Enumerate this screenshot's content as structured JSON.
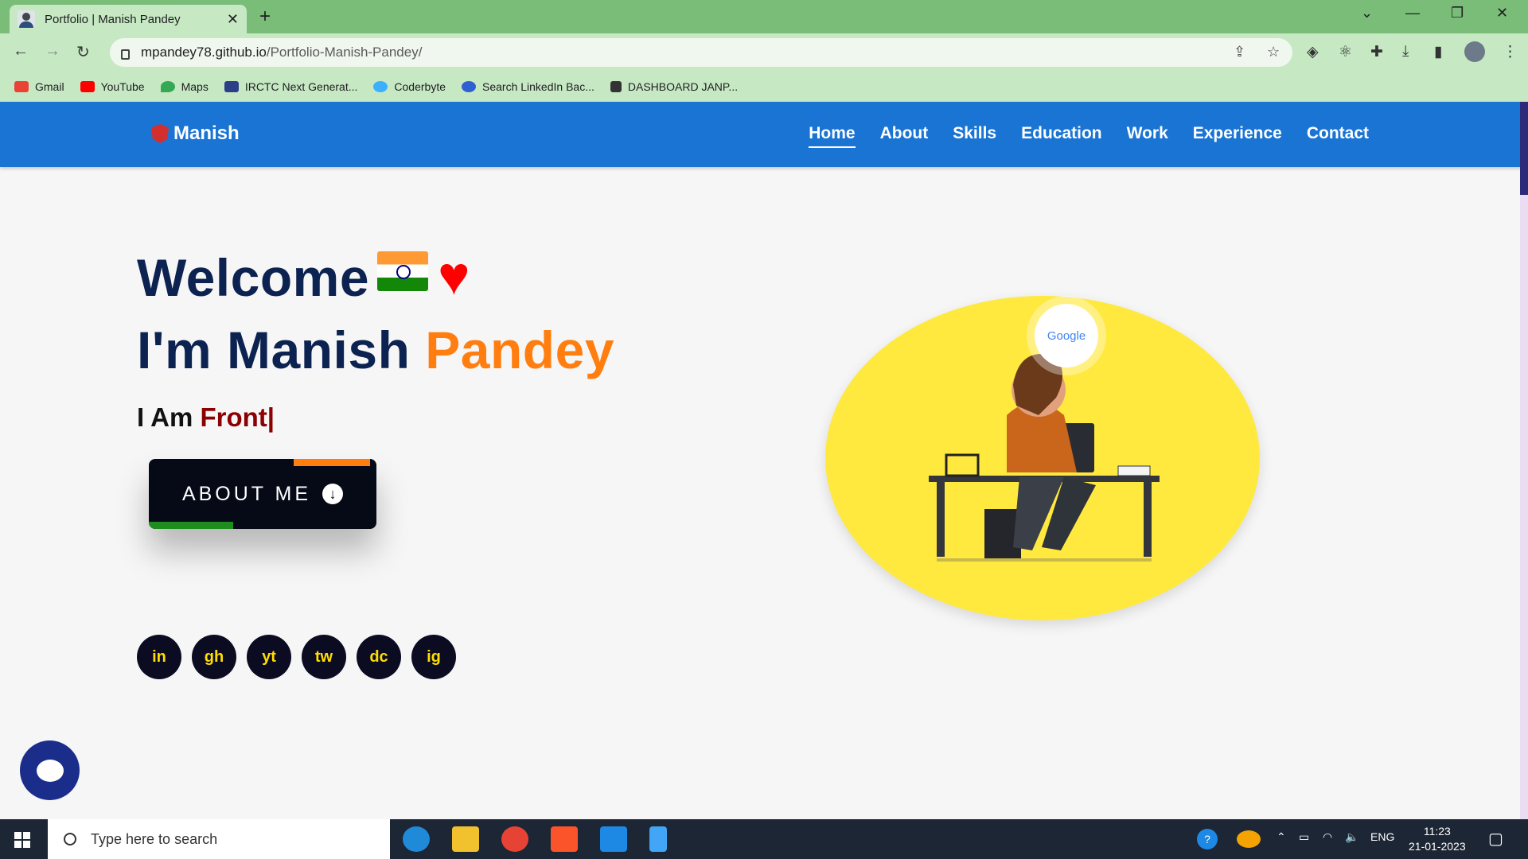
{
  "browser": {
    "tab_title": "Portfolio | Manish Pandey",
    "new_tab": "+",
    "url_host": "mpandey78.github.io",
    "url_path": "/Portfolio-Manish-Pandey/",
    "bookmarks": [
      "Gmail",
      "YouTube",
      "Maps",
      "IRCTC Next Generat...",
      "Coderbyte",
      "Search LinkedIn Bac...",
      "DASHBOARD JANP..."
    ]
  },
  "site": {
    "brand": "Manish",
    "menu": [
      "Home",
      "About",
      "Skills",
      "Education",
      "Work",
      "Experience",
      "Contact"
    ],
    "welcome": "Welcome",
    "heart": "♥",
    "name_prefix": "I'm Manish",
    "name_accent": "Pandey",
    "typed_prefix": "I Am",
    "typed_value": "Front|",
    "about_button": "ABOUT ME",
    "about_arrow": "↓",
    "socials": [
      "in",
      "gh",
      "yt",
      "tw",
      "dc",
      "ig"
    ],
    "google_label": "Google"
  },
  "taskbar": {
    "search_placeholder": "Type here to search",
    "language": "ENG",
    "time": "11:23",
    "date": "21-01-2023"
  },
  "colors": {
    "nav": "#1a74d4",
    "accent": "#ff7e0f",
    "heading": "#0c2250",
    "illustration_bg": "#ffe93e"
  }
}
